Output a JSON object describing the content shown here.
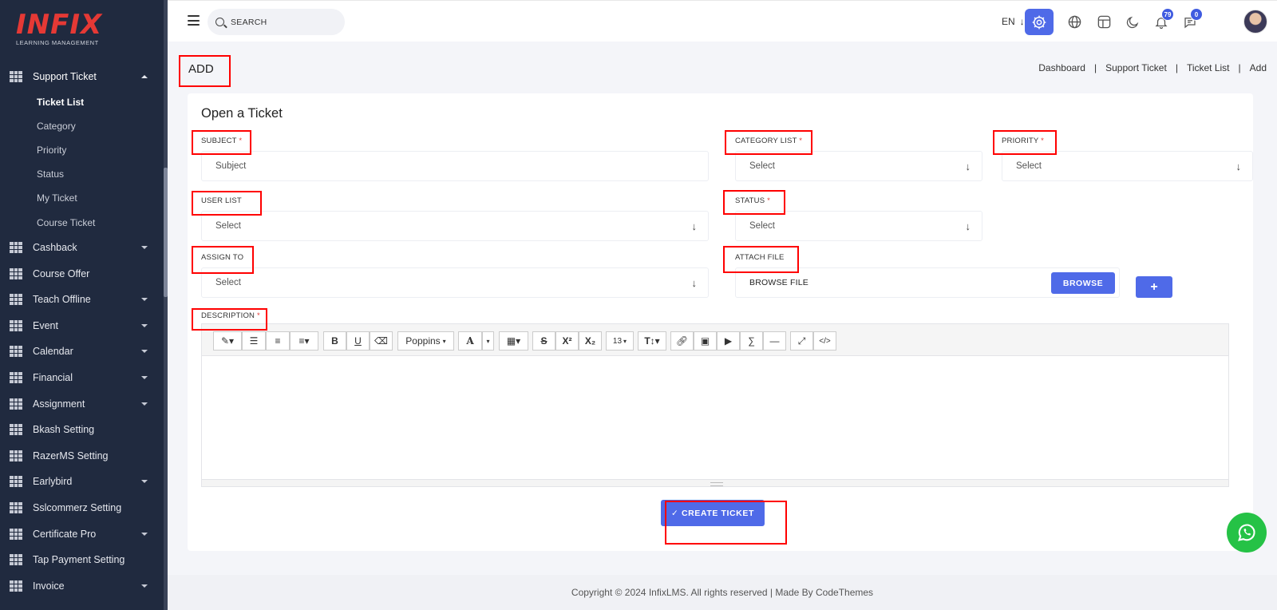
{
  "brand": {
    "name": "INFIX",
    "tagline": "LEARNING MANAGEMENT"
  },
  "sidebar": {
    "items": [
      {
        "label": "Support Ticket",
        "caret": "up"
      },
      {
        "label": "Cashback",
        "caret": "down"
      },
      {
        "label": "Course Offer",
        "caret": ""
      },
      {
        "label": "Teach Offline",
        "caret": "down"
      },
      {
        "label": "Event",
        "caret": "down"
      },
      {
        "label": "Calendar",
        "caret": "down"
      },
      {
        "label": "Financial",
        "caret": "down"
      },
      {
        "label": "Assignment",
        "caret": "down"
      },
      {
        "label": "Bkash Setting",
        "caret": ""
      },
      {
        "label": "RazerMS Setting",
        "caret": ""
      },
      {
        "label": "Earlybird",
        "caret": "down"
      },
      {
        "label": "Sslcommerz Setting",
        "caret": ""
      },
      {
        "label": "Certificate Pro",
        "caret": "down"
      },
      {
        "label": "Tap Payment Setting",
        "caret": ""
      },
      {
        "label": "Invoice",
        "caret": "down"
      }
    ],
    "sub_items": [
      "Ticket List",
      "Category",
      "Priority",
      "Status",
      "My Ticket",
      "Course Ticket"
    ]
  },
  "header": {
    "search_placeholder": "SEARCH",
    "language": "EN",
    "notification_count": "79",
    "message_count": "0"
  },
  "page": {
    "title": "ADD",
    "breadcrumb": [
      "Dashboard",
      "Support Ticket",
      "Ticket List",
      "Add"
    ]
  },
  "form": {
    "card_title": "Open a Ticket",
    "subject_label": "SUBJECT",
    "subject_placeholder": "Subject",
    "category_label": "CATEGORY LIST",
    "priority_label": "PRIORITY",
    "user_list_label": "USER LIST",
    "status_label": "STATUS",
    "assign_to_label": "ASSIGN TO",
    "attach_file_label": "ATTACH FILE",
    "select_placeholder": "Select",
    "browse_file_text": "BROWSE FILE",
    "browse_button": "BROWSE",
    "add_button": "+",
    "description_label": "DESCRIPTION",
    "required_mark": "*",
    "submit_button": "✓ CREATE TICKET"
  },
  "editor": {
    "font_name": "Poppins",
    "font_size": "13"
  },
  "footer": {
    "text": "Copyright © 2024 InfixLMS. All rights reserved | Made By CodeThemes"
  },
  "colors": {
    "accent": "#4f6ae8",
    "sidebar_bg": "#202a3f",
    "brand_red": "#e53935",
    "highlight": "#ff0000",
    "whatsapp": "#25c246"
  }
}
